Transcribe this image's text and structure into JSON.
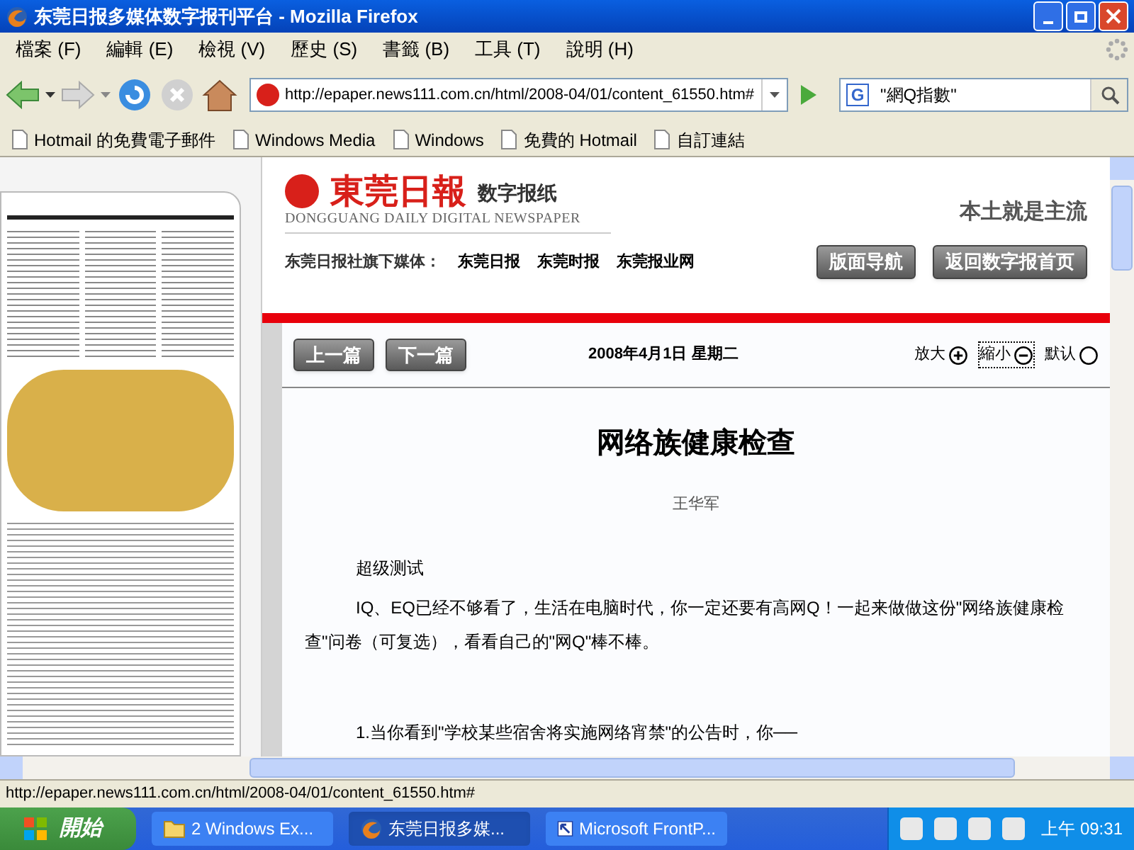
{
  "window": {
    "title": "东莞日报多媒体数字报刊平台 - Mozilla Firefox"
  },
  "menu": [
    "檔案 (F)",
    "編輯 (E)",
    "檢視 (V)",
    "歷史 (S)",
    "書籤 (B)",
    "工具 (T)",
    "說明 (H)"
  ],
  "toolbar": {
    "url": "http://epaper.news111.com.cn/html/2008-04/01/content_61550.htm#",
    "engine": "G",
    "search": "\"網Q指數\""
  },
  "bookmarks": [
    "Hotmail 的免費電子郵件",
    "Windows Media",
    "Windows",
    "免費的 Hotmail",
    "自訂連結"
  ],
  "page": {
    "masthead": {
      "logo": "東莞日報",
      "subtitle": "数字报纸",
      "english": "DONGGUANG DAILY DIGITAL NEWSPAPER",
      "slogan": "本土就是主流"
    },
    "media_line": {
      "label": "东莞日报社旗下媒体：",
      "links": [
        "东莞日报",
        "东莞时报",
        "东莞报业网"
      ]
    },
    "nav_buttons": [
      "版面导航",
      "返回数字报首页"
    ],
    "article_nav": [
      "上一篇",
      "下一篇"
    ],
    "date": "2008年4月1日 星期二",
    "zoom_options": [
      {
        "kind": "plus",
        "label": "放大",
        "focused": false
      },
      {
        "kind": "minus",
        "label": "縮小",
        "focused": true
      },
      {
        "kind": "default",
        "label": "默认",
        "focused": false
      }
    ],
    "article": {
      "title": "网络族健康检查",
      "author": "王华军",
      "paragraphs": [
        "超级测试",
        "IQ、EQ已经不够看了，生活在电脑时代，你一定还要有高网Q！一起来做做这份\"网络族健康检查\"问卷（可复选），看看自己的\"网Q\"棒不棒。",
        "1.当你看到\"学校某些宿舍将实施网络宵禁\"的公告时，你──"
      ]
    }
  },
  "status_bar": "http://epaper.news111.com.cn/html/2008-04/01/content_61550.htm#",
  "taskbar": {
    "start": "開始",
    "tasks": [
      {
        "label": "2 Windows Ex...",
        "kind": "folder",
        "selected": false
      },
      {
        "label": "东莞日报多媒...",
        "kind": "firefox",
        "selected": true
      },
      {
        "label": "Microsoft FrontP...",
        "kind": "frontpage",
        "selected": false
      }
    ],
    "clock": "上午 09:31"
  }
}
